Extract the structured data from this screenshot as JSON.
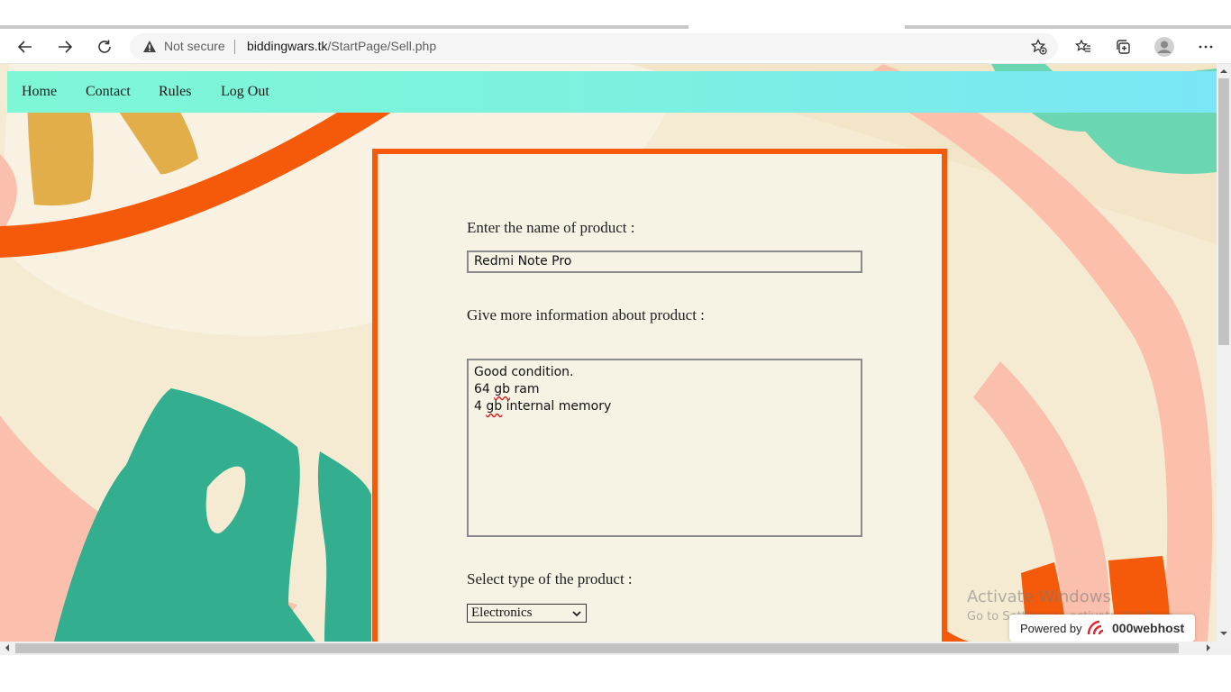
{
  "browser": {
    "security_label": "Not secure",
    "url_host": "biddingwars.tk",
    "url_path": "/StartPage/Sell.php",
    "icons": [
      "back-icon",
      "forward-icon",
      "refresh-icon",
      "warning-icon",
      "add-favorite-icon",
      "favorites-icon",
      "collections-icon",
      "profile-icon",
      "more-icon"
    ]
  },
  "nav": {
    "items": [
      {
        "label": "Home"
      },
      {
        "label": "Contact"
      },
      {
        "label": "Rules"
      },
      {
        "label": "Log Out"
      }
    ]
  },
  "form": {
    "name_label": "Enter the name of product :",
    "name_value": "Redmi Note Pro",
    "info_label": "Give more information about product :",
    "info_lines": [
      "Good condition.",
      "64 gb ram",
      "4 gb internal memory"
    ],
    "type_label": "Select type of the product :",
    "type_selected": "Electronics"
  },
  "watermark": {
    "line1": "Activate Windows",
    "line2": "Go to Settings to activate Windows."
  },
  "badge": {
    "powered_by": "Powered by",
    "brand": "000webhost"
  },
  "colors": {
    "accent_orange": "#f45a09",
    "nav_gradient_start": "#7ef7d6",
    "nav_gradient_end": "#7ae6f6",
    "background": "#f6f0dc",
    "leaf_green": "#33ae8e",
    "mustard": "#e2ae4a",
    "pink": "#fbbfae"
  }
}
